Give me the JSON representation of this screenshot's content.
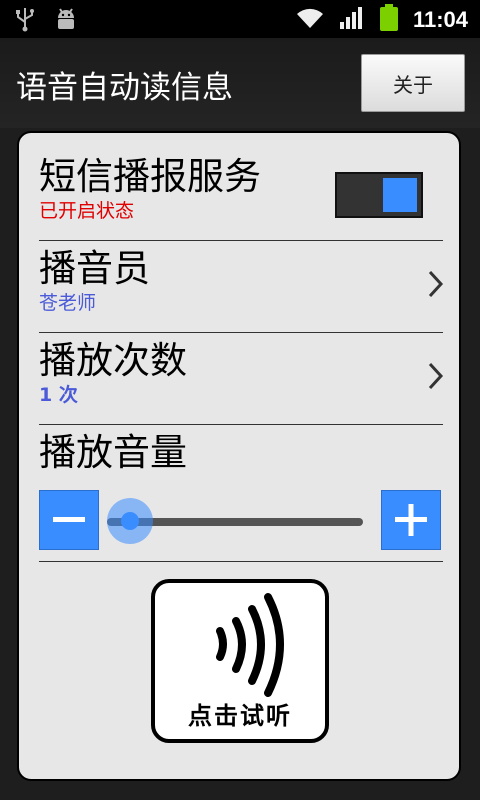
{
  "status_bar": {
    "time": "11:04",
    "icons": [
      "usb-icon",
      "android-debug-icon",
      "wifi-icon",
      "signal-icon",
      "battery-icon"
    ]
  },
  "header": {
    "title": "语音自动读信息",
    "about_label": "关于"
  },
  "settings": {
    "sms_service": {
      "title": "短信播报服务",
      "status": "已开启状态",
      "status_color": "#e00000",
      "enabled": true
    },
    "announcer": {
      "title": "播音员",
      "value": "苍老师",
      "value_color": "#4a5ad8"
    },
    "play_count": {
      "title": "播放次数",
      "value": "1 次",
      "value_color": "#4a5ad8"
    },
    "volume": {
      "title": "播放音量",
      "level_fraction": 0.05
    }
  },
  "listen_button": {
    "label": "点击试听"
  },
  "colors": {
    "accent": "#3a8dff",
    "card_bg": "#e7e7e7"
  }
}
